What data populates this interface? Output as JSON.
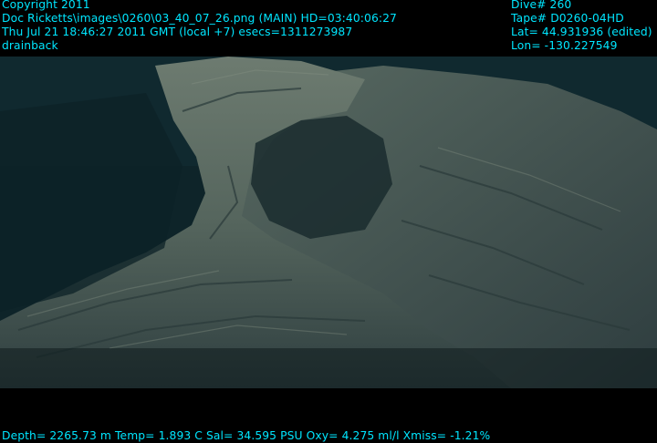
{
  "overlay": {
    "top_left": [
      "Copyright 2011",
      "Doc Ricketts\\images\\0260\\03_40_07_26.png (MAIN)  HD=03:40:06:27",
      "Thu Jul 21 18:46:27 2011 GMT (local +7)  esecs=1311273987",
      "drainback"
    ],
    "top_right": [
      "Dive# 260",
      "Tape# D0260-04HD",
      "Lat= 44.931936 (edited)",
      "Lon= -130.227549"
    ],
    "bottom": "Depth= 2265.73 m  Temp= 1.893 C  Sal= 34.595 PSU  Oxy= 4.275 ml/l  Xmiss= -1.21%"
  },
  "colors": {
    "overlay_text": "#00e6ff",
    "background": "#000000",
    "water": "#0d2228",
    "rock_light": "#6c7a6f",
    "rock_mid": "#4a5a55",
    "rock_dark": "#26353a"
  },
  "scene": {
    "subject": "seafloor lava rock formation with arch"
  }
}
